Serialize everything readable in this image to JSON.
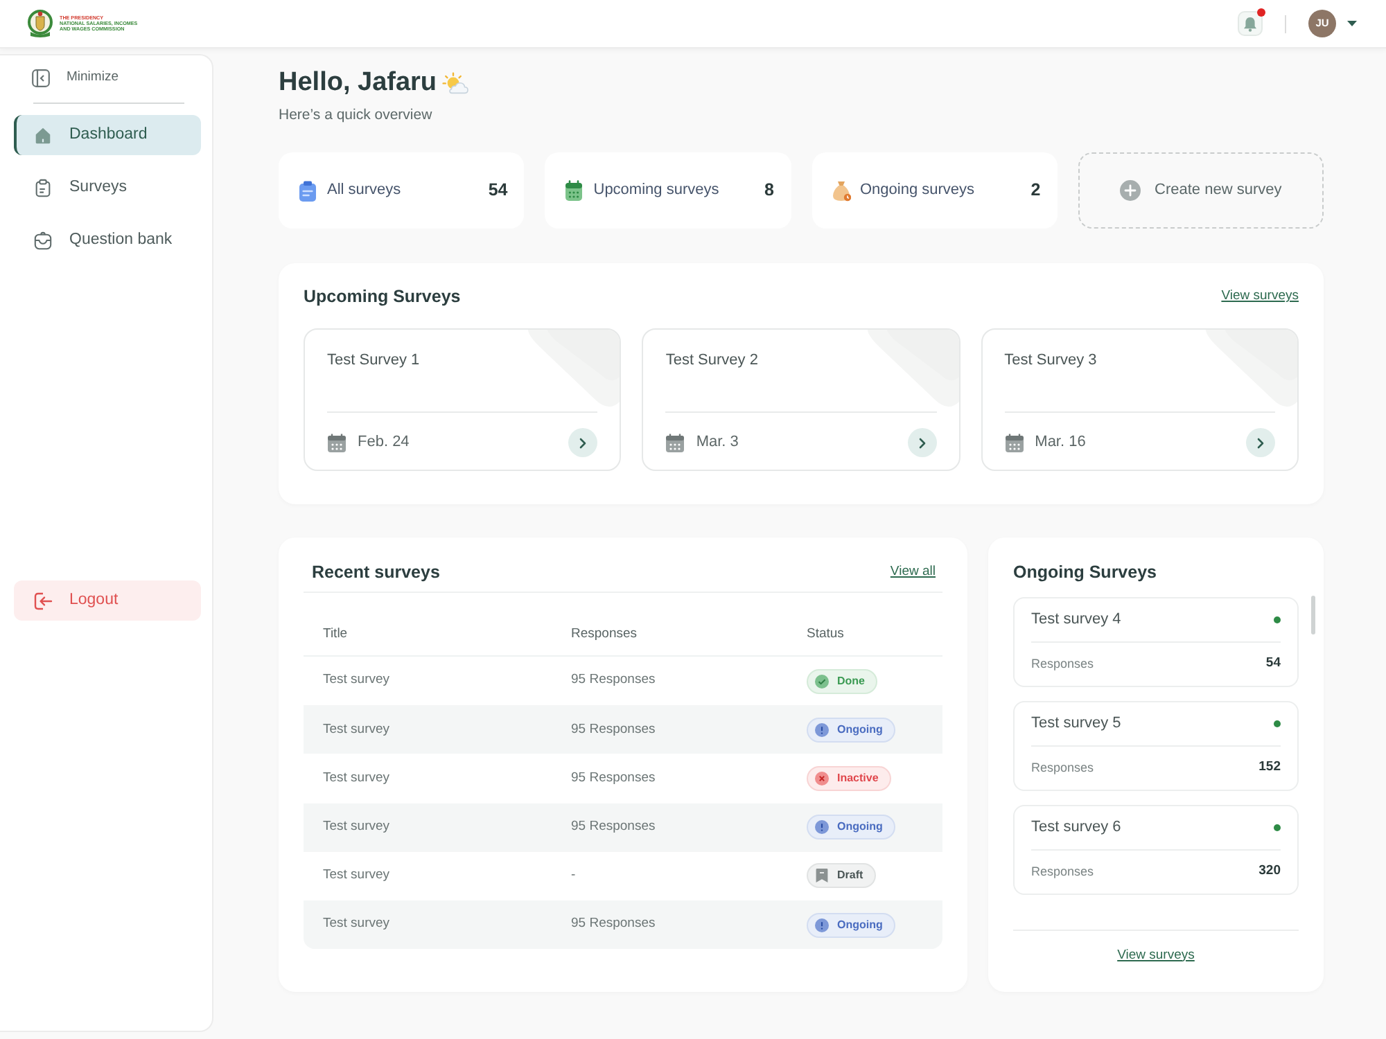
{
  "topbar": {
    "logo_lines": [
      "THE PRESIDENCY",
      "NATIONAL SALARIES, INCOMES",
      "AND WAGES COMMISSION"
    ],
    "notifications": {
      "unread": true
    },
    "user": {
      "initials": "JU"
    }
  },
  "sidebar": {
    "minimize": "Minimize",
    "items": [
      {
        "label": "Dashboard",
        "kind": "home",
        "selected": true
      },
      {
        "label": "Surveys",
        "kind": "surveys",
        "selected": false
      },
      {
        "label": "Question bank",
        "kind": "bank",
        "selected": false
      }
    ],
    "logout": "Logout"
  },
  "greeting": {
    "title": "Hello, Jafaru",
    "subtitle": "Here’s a quick overview"
  },
  "stats": [
    {
      "kind": "all",
      "label": "All surveys",
      "count": "54"
    },
    {
      "kind": "upcoming",
      "label": "Upcoming surveys",
      "count": "8"
    },
    {
      "kind": "ongoing",
      "label": "Ongoing surveys",
      "count": "2"
    }
  ],
  "create_button": "Create new survey",
  "upcoming": {
    "title": "Upcoming Surveys",
    "link": "View surveys",
    "surveys": [
      {
        "title": "Test Survey 1",
        "date": "Feb. 24"
      },
      {
        "title": "Test Survey 2",
        "date": "Mar. 3"
      },
      {
        "title": "Test Survey 3",
        "date": "Mar. 16"
      }
    ]
  },
  "recent": {
    "title": "Recent surveys",
    "link": "View all",
    "columns": [
      "Title",
      "Responses",
      "Status"
    ],
    "rows": [
      {
        "title": "Test survey",
        "responses": "95 Responses",
        "status": {
          "kind": "done",
          "label": "Done"
        }
      },
      {
        "title": "Test survey",
        "responses": "95 Responses",
        "status": {
          "kind": "ongoing",
          "label": "Ongoing"
        }
      },
      {
        "title": "Test survey",
        "responses": "95 Responses",
        "status": {
          "kind": "inactive",
          "label": "Inactive"
        }
      },
      {
        "title": "Test survey",
        "responses": "95 Responses",
        "status": {
          "kind": "ongoing",
          "label": "Ongoing"
        }
      },
      {
        "title": "Test survey",
        "responses": "-",
        "status": {
          "kind": "draft",
          "label": "Draft"
        }
      },
      {
        "title": "Test survey",
        "responses": "95 Responses",
        "status": {
          "kind": "ongoing",
          "label": "Ongoing"
        }
      }
    ]
  },
  "ongoing": {
    "title": "Ongoing Surveys",
    "surveys": [
      {
        "title": "Test survey 4",
        "label": "Responses",
        "count": "54"
      },
      {
        "title": "Test survey 5",
        "label": "Responses",
        "count": "152"
      },
      {
        "title": "Test survey 6",
        "label": "Responses",
        "count": "320"
      }
    ],
    "link": "View surveys"
  }
}
